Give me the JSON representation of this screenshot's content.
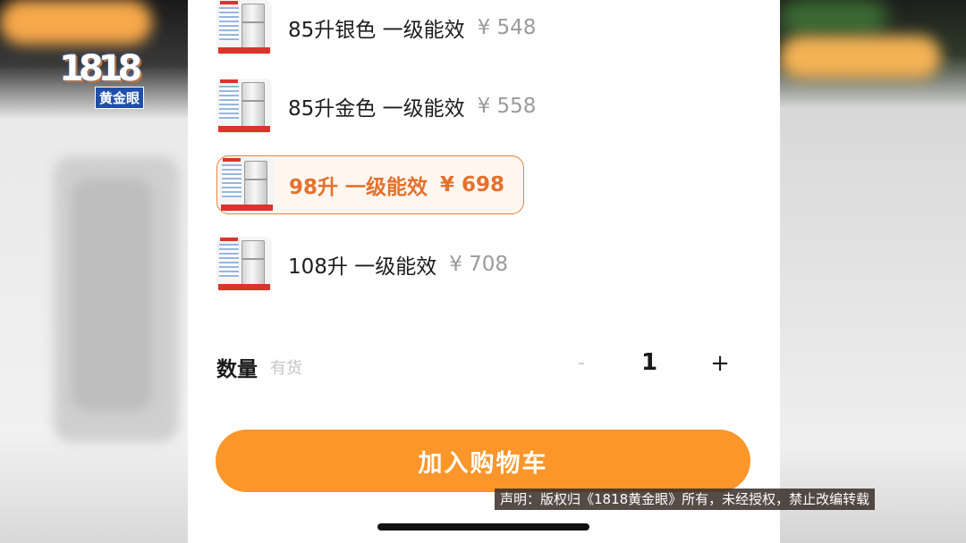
{
  "logo": {
    "number": "1818",
    "tag": "黄金眼"
  },
  "options": [
    {
      "label": "85升银色 一级能效",
      "price": "¥ 548",
      "selected": false
    },
    {
      "label": "85升金色 一级能效",
      "price": "¥ 558",
      "selected": false
    },
    {
      "label": "98升 一级能效",
      "price": "¥ 698",
      "selected": true
    },
    {
      "label": "108升 一级能效",
      "price": "¥ 708",
      "selected": false
    }
  ],
  "quantity": {
    "title": "数量",
    "stock": "有货",
    "minus": "-",
    "value": "1",
    "plus": "+"
  },
  "cart_button": "加入购物车",
  "notice": "声明：版权归《1818黄金眼》所有，未经授权，禁止改编转载",
  "colors": {
    "accent": "#fb962a",
    "selected_text": "#e4712c",
    "selected_border": "#e58240"
  }
}
